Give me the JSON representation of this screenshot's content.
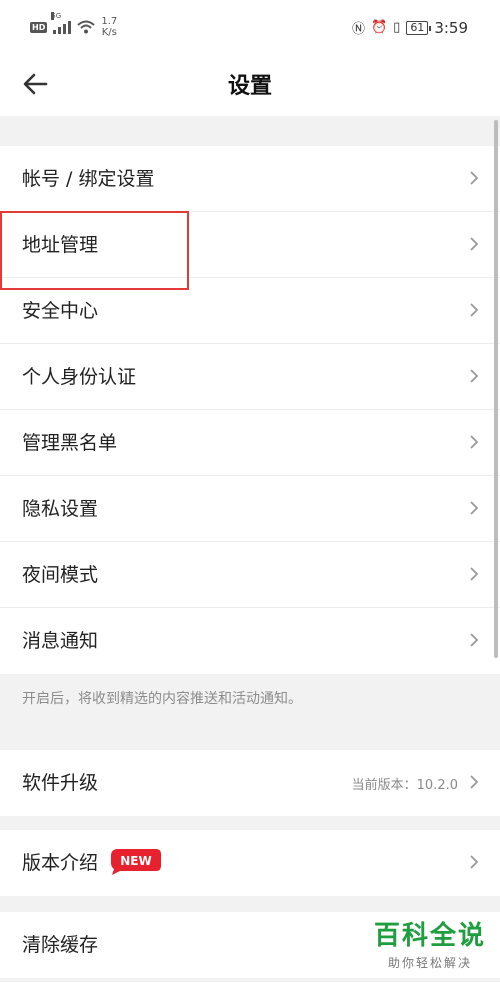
{
  "status_bar": {
    "left_badge": "HD",
    "signal_label": "5G",
    "speed_value": "1.7",
    "speed_unit": "K/s",
    "battery": "61",
    "time": "3:59",
    "icons": [
      "hd-icon",
      "signal-icon",
      "wifi-icon",
      "nfc-icon",
      "alarm-icon",
      "vibrate-icon",
      "battery-icon"
    ]
  },
  "header": {
    "title": "设置",
    "back_icon": "arrow-left-icon"
  },
  "groups": {
    "main": {
      "items": [
        {
          "label": "帐号 / 绑定设置"
        },
        {
          "label": "地址管理"
        },
        {
          "label": "安全中心"
        },
        {
          "label": "个人身份认证"
        },
        {
          "label": "管理黑名单"
        },
        {
          "label": "隐私设置"
        },
        {
          "label": "夜间模式"
        },
        {
          "label": "消息通知"
        }
      ],
      "hint": "开启后，将收到精选的内容推送和活动通知。"
    },
    "update": {
      "label": "软件升级",
      "value": "当前版本：10.2.0"
    },
    "intro": {
      "label": "版本介绍",
      "badge": "NEW"
    },
    "cache": {
      "label": "清除缓存"
    }
  },
  "watermark": {
    "title": "百科全说",
    "subtitle": "助你轻松解决"
  },
  "colors": {
    "highlight": "#e53935",
    "badge": "#e8212e",
    "watermark": "#1e9e3e"
  }
}
